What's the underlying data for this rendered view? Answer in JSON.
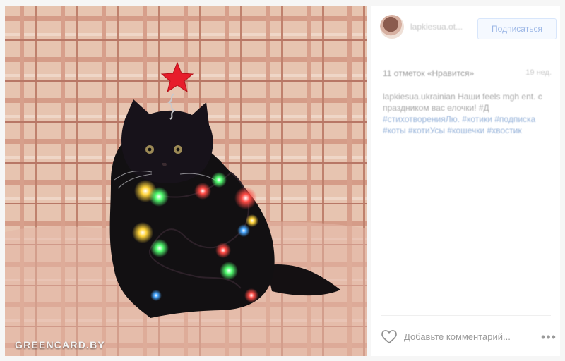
{
  "post": {
    "username": "lapkiesua.ot...",
    "follow_label": "Подписаться",
    "likes": "11 отметок «Нравится»",
    "date": "19 нед.",
    "caption_lines": [
      "lapkiesua.ukrainian Наши feels mgh ent. с",
      "праздником вас елочки! #Д",
      "#стихотворенияЛю. #котики #подписка",
      "#коты #котиУсы #кошечки #хвостик"
    ],
    "comment_placeholder": "Добавьте комментарий...",
    "more_label": "•••",
    "watermark": "GREENCARD.BY"
  },
  "icons": {
    "heart": "heart-icon",
    "more": "more-options-icon"
  },
  "colors": {
    "accent": "#98b4da",
    "star": "#e71d2b",
    "light_blue": "#9cb7e6"
  }
}
